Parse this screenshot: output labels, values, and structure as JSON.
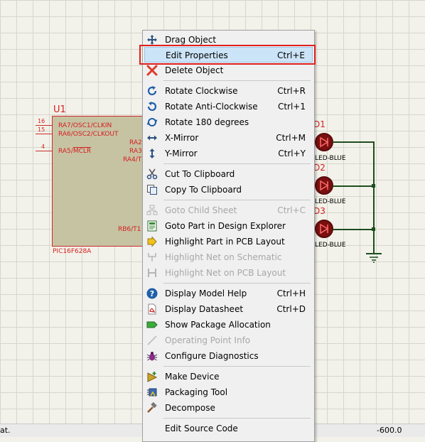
{
  "schematic": {
    "chip": {
      "refdes": "U1",
      "part": "PIC16F628A",
      "pins_left": [
        {
          "num": "16",
          "label": "RA7/OSC1/CLKIN"
        },
        {
          "num": "15",
          "label": "RA6/OSC2/CLKOUT"
        },
        {
          "num": "4",
          "label_prefix": "RA5/",
          "label_over": "MCLR"
        }
      ],
      "pins_right": [
        "RA2",
        "RA3",
        "RA4/T",
        "RB6/T1"
      ]
    },
    "leds": [
      {
        "refdes": "D1",
        "value": "LED-BLUE"
      },
      {
        "refdes": "D2",
        "value": "LED-BLUE"
      },
      {
        "refdes": "D3",
        "value": "LED-BLUE"
      }
    ]
  },
  "statusbar": {
    "left_text": "at.",
    "right_text": "-600.0"
  },
  "context_menu": {
    "items": [
      {
        "label": "Drag Object",
        "shortcut": "",
        "icon": "move-icon",
        "disabled": false
      },
      {
        "label": "Edit Properties",
        "shortcut": "Ctrl+E",
        "icon": "",
        "disabled": false,
        "highlighted": true
      },
      {
        "label": "Delete Object",
        "shortcut": "",
        "icon": "delete-x-icon",
        "disabled": false
      },
      {
        "label": "Rotate Clockwise",
        "shortcut": "Ctrl+R",
        "icon": "rotate-cw-icon",
        "disabled": false
      },
      {
        "label": "Rotate Anti-Clockwise",
        "shortcut": "Ctrl+1",
        "icon": "rotate-ccw-icon",
        "disabled": false
      },
      {
        "label": "Rotate 180 degrees",
        "shortcut": "",
        "icon": "rotate-180-icon",
        "disabled": false
      },
      {
        "label": "X-Mirror",
        "shortcut": "Ctrl+M",
        "icon": "x-mirror-icon",
        "disabled": false
      },
      {
        "label": "Y-Mirror",
        "shortcut": "Ctrl+Y",
        "icon": "y-mirror-icon",
        "disabled": false
      },
      {
        "label": "Cut To Clipboard",
        "shortcut": "",
        "icon": "scissors-icon",
        "disabled": false
      },
      {
        "label": "Copy To Clipboard",
        "shortcut": "",
        "icon": "copy-icon",
        "disabled": false
      },
      {
        "label": "Goto Child Sheet",
        "shortcut": "Ctrl+C",
        "icon": "child-sheet-icon",
        "disabled": true
      },
      {
        "label": "Goto Part in Design Explorer",
        "shortcut": "",
        "icon": "design-explorer-icon",
        "disabled": false
      },
      {
        "label": "Highlight Part in PCB Layout",
        "shortcut": "",
        "icon": "pcb-arrow-icon",
        "disabled": false
      },
      {
        "label": "Highlight Net on Schematic",
        "shortcut": "",
        "icon": "net-schematic-icon",
        "disabled": true
      },
      {
        "label": "Highlight Net on PCB Layout",
        "shortcut": "",
        "icon": "net-pcb-icon",
        "disabled": true
      },
      {
        "label": "Display Model Help",
        "shortcut": "Ctrl+H",
        "icon": "help-icon",
        "disabled": false
      },
      {
        "label": "Display Datasheet",
        "shortcut": "Ctrl+D",
        "icon": "pdf-icon",
        "disabled": false
      },
      {
        "label": "Show Package Allocation",
        "shortcut": "",
        "icon": "package-icon",
        "disabled": false
      },
      {
        "label": "Operating Point Info",
        "shortcut": "",
        "icon": "probe-icon",
        "disabled": true
      },
      {
        "label": "Configure Diagnostics",
        "shortcut": "",
        "icon": "bug-icon",
        "disabled": false
      },
      {
        "label": "Make Device",
        "shortcut": "",
        "icon": "make-device-icon",
        "disabled": false
      },
      {
        "label": "Packaging Tool",
        "shortcut": "",
        "icon": "packaging-tool-icon",
        "disabled": false
      },
      {
        "label": "Decompose",
        "shortcut": "",
        "icon": "hammer-icon",
        "disabled": false
      },
      {
        "label": "Edit Source Code",
        "shortcut": "",
        "icon": "",
        "disabled": false
      }
    ]
  },
  "colors": {
    "highlight_box": "#e02020",
    "selection": "#cce4f7",
    "schematic_red": "#d42020",
    "wire": "#1e4d1e"
  }
}
